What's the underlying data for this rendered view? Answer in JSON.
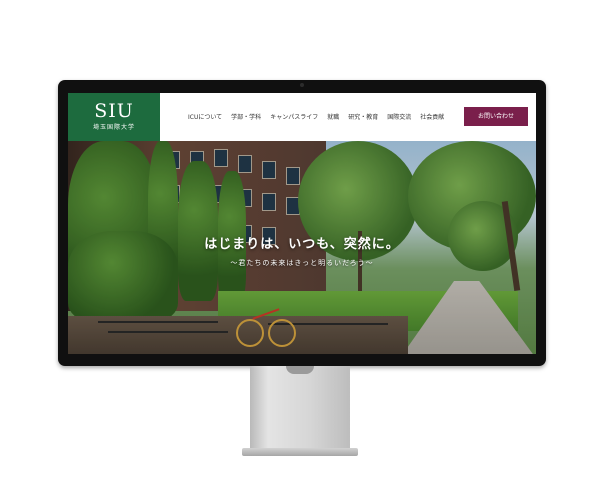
{
  "site": {
    "logo": {
      "main": "SIU",
      "sub": "埼玉国際大学"
    },
    "nav": {
      "items": [
        "ICUについて",
        "学部・学科",
        "キャンパスライフ",
        "就職",
        "研究・教育",
        "国際交流",
        "社会貢献"
      ]
    },
    "contact_button": "お問い合わせ",
    "hero": {
      "title": "はじまりは、いつも、突然に。",
      "subtitle": "～君たちの未来はきっと明るいだろう～"
    }
  },
  "colors": {
    "brand_green": "#1d6b3e",
    "contact_button": "#7a1f4b"
  }
}
